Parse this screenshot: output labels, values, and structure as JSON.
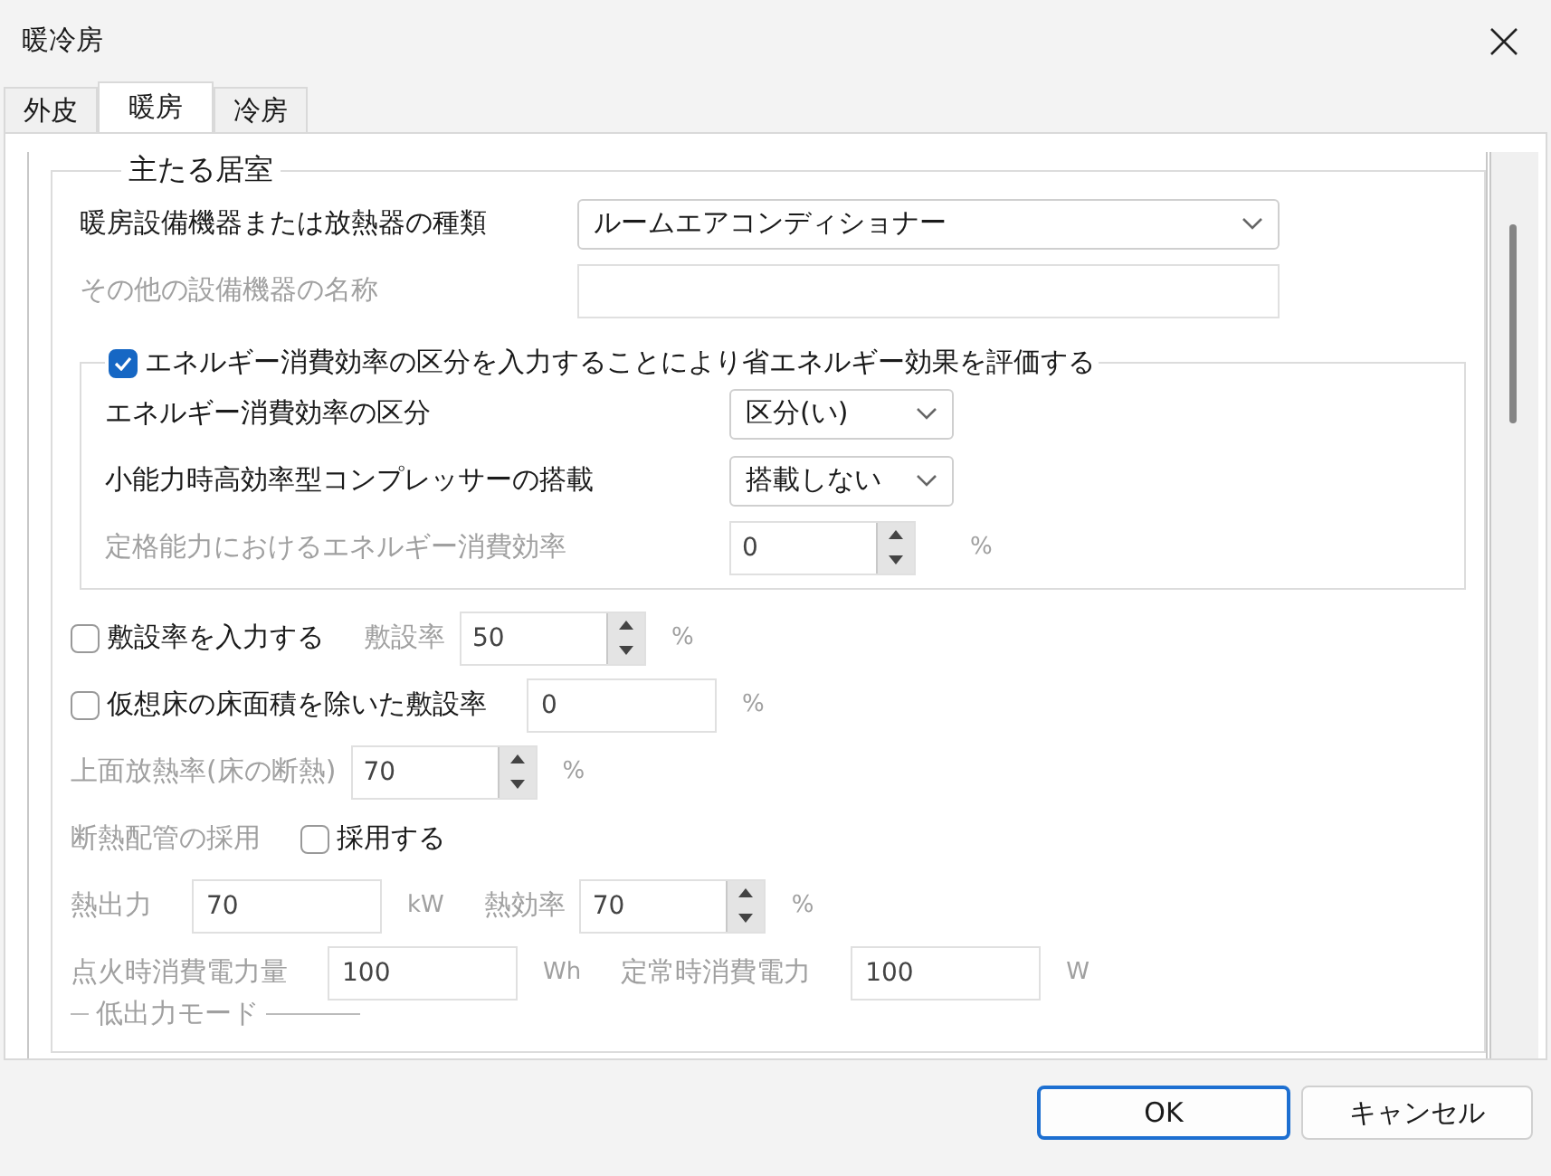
{
  "window": {
    "title": "暖冷房"
  },
  "tabs": [
    {
      "label": "外皮",
      "selected": false
    },
    {
      "label": "暖房",
      "selected": true
    },
    {
      "label": "冷房",
      "selected": false
    }
  ],
  "group": {
    "title": "主たる居室"
  },
  "heater_type": {
    "label": "暖房設備機器または放熱器の種類",
    "value": "ルームエアコンディショナー",
    "disabled": false
  },
  "other_name": {
    "label": "その他の設備機器の名称",
    "disabled": true
  },
  "efficiency_group": {
    "label": "エネルギー消費効率の区分を入力することにより省エネルギー効果を評価する",
    "checked": true,
    "rows": [
      {
        "kind": "select",
        "label": "エネルギー消費効率の区分",
        "value": "区分(い)",
        "disabled": false
      },
      {
        "kind": "select",
        "label": "小能力時高効率型コンプレッサーの搭載",
        "value": "搭載しない",
        "disabled": false
      },
      {
        "kind": "spinner",
        "label": "定格能力におけるエネルギー消費効率",
        "value": "0",
        "unit": "%",
        "disabled": true
      }
    ]
  },
  "rows": [
    [
      {
        "kind": "checkbox",
        "label": "敷設率を入力する",
        "checked": false,
        "disabled": false
      },
      {
        "kind": "label",
        "label": "敷設率",
        "disabled": true
      },
      {
        "kind": "spinner",
        "value": "50",
        "disabled": true
      },
      {
        "kind": "unit",
        "label": "%",
        "disabled": true
      }
    ],
    [
      {
        "kind": "checkbox",
        "label": "仮想床の床面積を除いた敷設率",
        "checked": false,
        "disabled": false
      },
      {
        "kind": "input",
        "value": "0",
        "disabled": true
      },
      {
        "kind": "unit",
        "label": "%",
        "disabled": true
      }
    ],
    [
      {
        "kind": "label",
        "label": "上面放熱率(床の断熱)",
        "disabled": true
      },
      {
        "kind": "spinner",
        "value": "70",
        "disabled": true
      },
      {
        "kind": "unit",
        "label": "%",
        "disabled": true
      }
    ],
    [
      {
        "kind": "label",
        "label": "断熱配管の採用",
        "disabled": true
      },
      {
        "kind": "checkbox",
        "label": "採用する",
        "checked": false,
        "disabled": false
      }
    ],
    [
      {
        "kind": "label",
        "label": "熱出力",
        "disabled": true
      },
      {
        "kind": "input",
        "value": "70",
        "disabled": true
      },
      {
        "kind": "unit",
        "label": "kW",
        "disabled": true
      },
      {
        "kind": "label",
        "label": "熱効率",
        "disabled": true
      },
      {
        "kind": "spinner",
        "value": "70",
        "disabled": true
      },
      {
        "kind": "unit",
        "label": "%",
        "disabled": true
      }
    ],
    [
      {
        "kind": "label",
        "label": "点火時消費電力量",
        "disabled": true
      },
      {
        "kind": "input",
        "value": "100",
        "disabled": true
      },
      {
        "kind": "unit",
        "label": "Wh",
        "disabled": true
      },
      {
        "kind": "label",
        "label": "定常時消費電力",
        "disabled": true
      },
      {
        "kind": "input",
        "value": "100",
        "disabled": true
      },
      {
        "kind": "unit",
        "label": "W",
        "disabled": true
      }
    ]
  ],
  "sub_group": {
    "title": "低出力モード"
  },
  "buttons": [
    {
      "label": "OK",
      "default": true
    },
    {
      "label": "キャンセル",
      "default": false
    }
  ]
}
